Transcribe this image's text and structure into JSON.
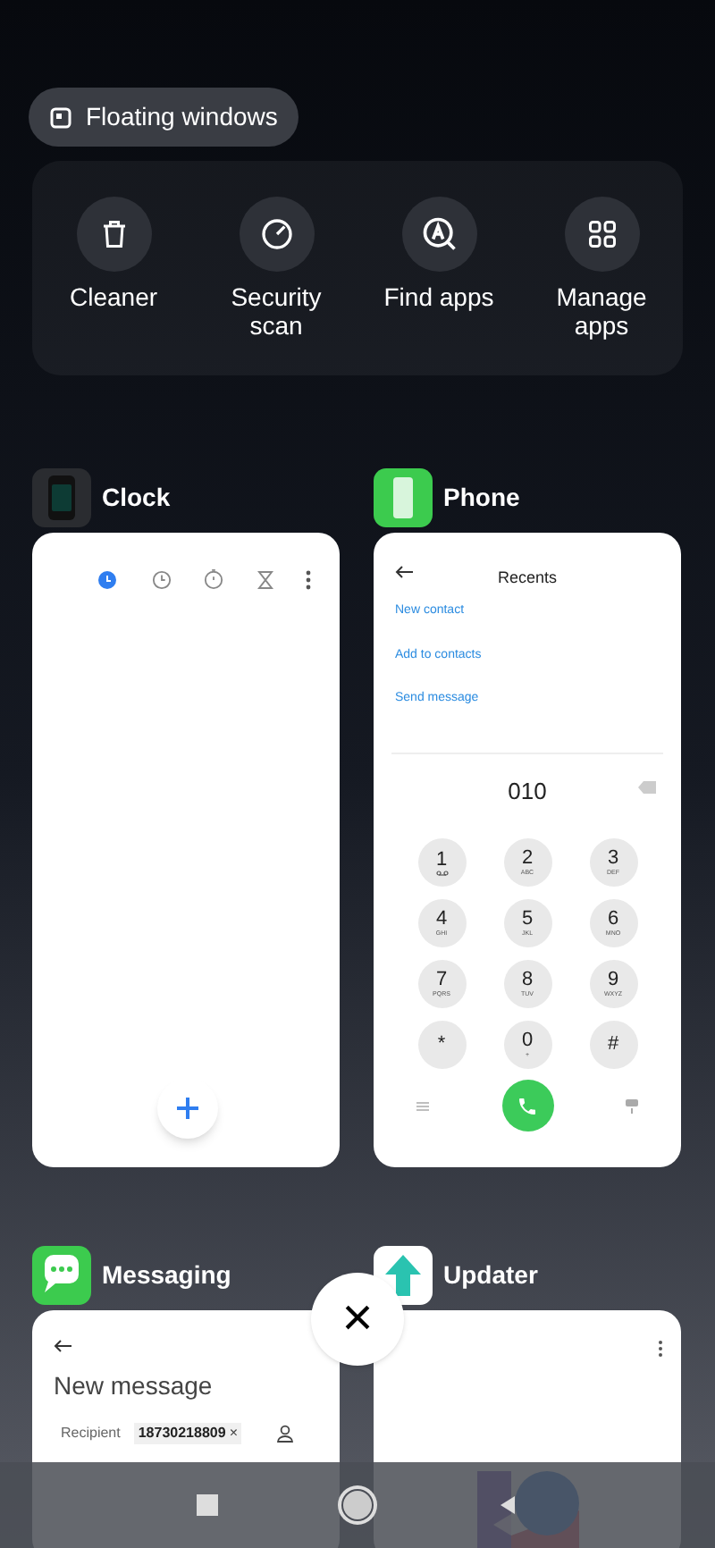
{
  "floating_windows": {
    "label": "Floating windows"
  },
  "shortcuts": [
    {
      "kind": "cleaner",
      "label": "Cleaner"
    },
    {
      "kind": "security",
      "label": "Security scan"
    },
    {
      "kind": "find",
      "label": "Find apps"
    },
    {
      "kind": "manage",
      "label": "Manage apps"
    }
  ],
  "apps": [
    {
      "kind": "clock",
      "name": "Clock"
    },
    {
      "kind": "phone",
      "name": "Phone",
      "title": "Recents",
      "actions": [
        "New contact",
        "Add to contacts",
        "Send message"
      ],
      "number": "010",
      "keys": [
        {
          "digit": "1",
          "kind": "voicemail"
        },
        {
          "digit": "2",
          "letters": "ABC"
        },
        {
          "digit": "3",
          "letters": "DEF"
        },
        {
          "digit": "4",
          "letters": "GHI"
        },
        {
          "digit": "5",
          "letters": "JKL"
        },
        {
          "digit": "6",
          "letters": "MNO"
        },
        {
          "digit": "7",
          "letters": "PQRS"
        },
        {
          "digit": "8",
          "letters": "TUV"
        },
        {
          "digit": "9",
          "letters": "WXYZ"
        },
        {
          "digit": "*"
        },
        {
          "digit": "0",
          "letters": "+"
        },
        {
          "digit": "#"
        }
      ]
    },
    {
      "kind": "messaging",
      "name": "Messaging",
      "title": "New message",
      "recipient_label": "Recipient",
      "recipient": "18730218809",
      "recipient_remove": "×"
    },
    {
      "kind": "updater",
      "name": "Updater"
    }
  ],
  "close": {
    "label": "×"
  }
}
